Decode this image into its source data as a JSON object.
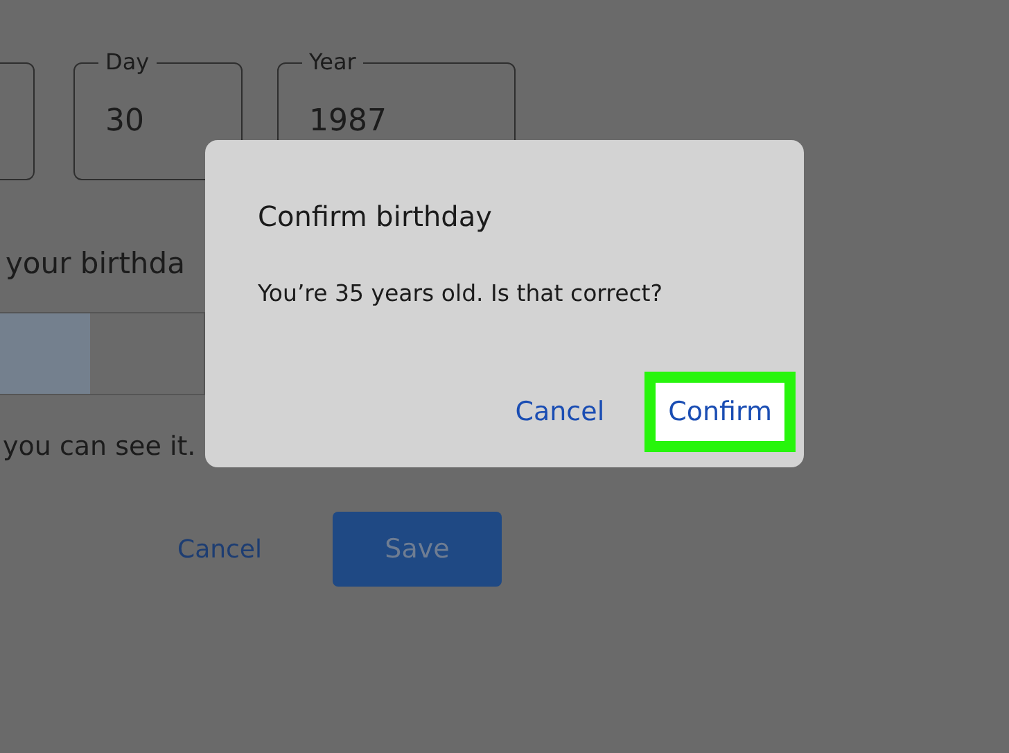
{
  "form": {
    "fields": [
      {
        "label": "Day",
        "value": "30"
      },
      {
        "label": "Year",
        "value": "1987"
      }
    ],
    "prompt": "your birthda",
    "note": "you can see it.",
    "buttons": [
      {
        "label": "Cancel",
        "kind": "text"
      },
      {
        "label": "Save",
        "kind": "filled"
      }
    ]
  },
  "dialog": {
    "title": "Confirm birthday",
    "message": "You’re 35 years old. Is that correct?",
    "buttons": [
      {
        "label": "Cancel",
        "highlighted": false
      },
      {
        "label": "Confirm",
        "highlighted": true
      }
    ]
  }
}
